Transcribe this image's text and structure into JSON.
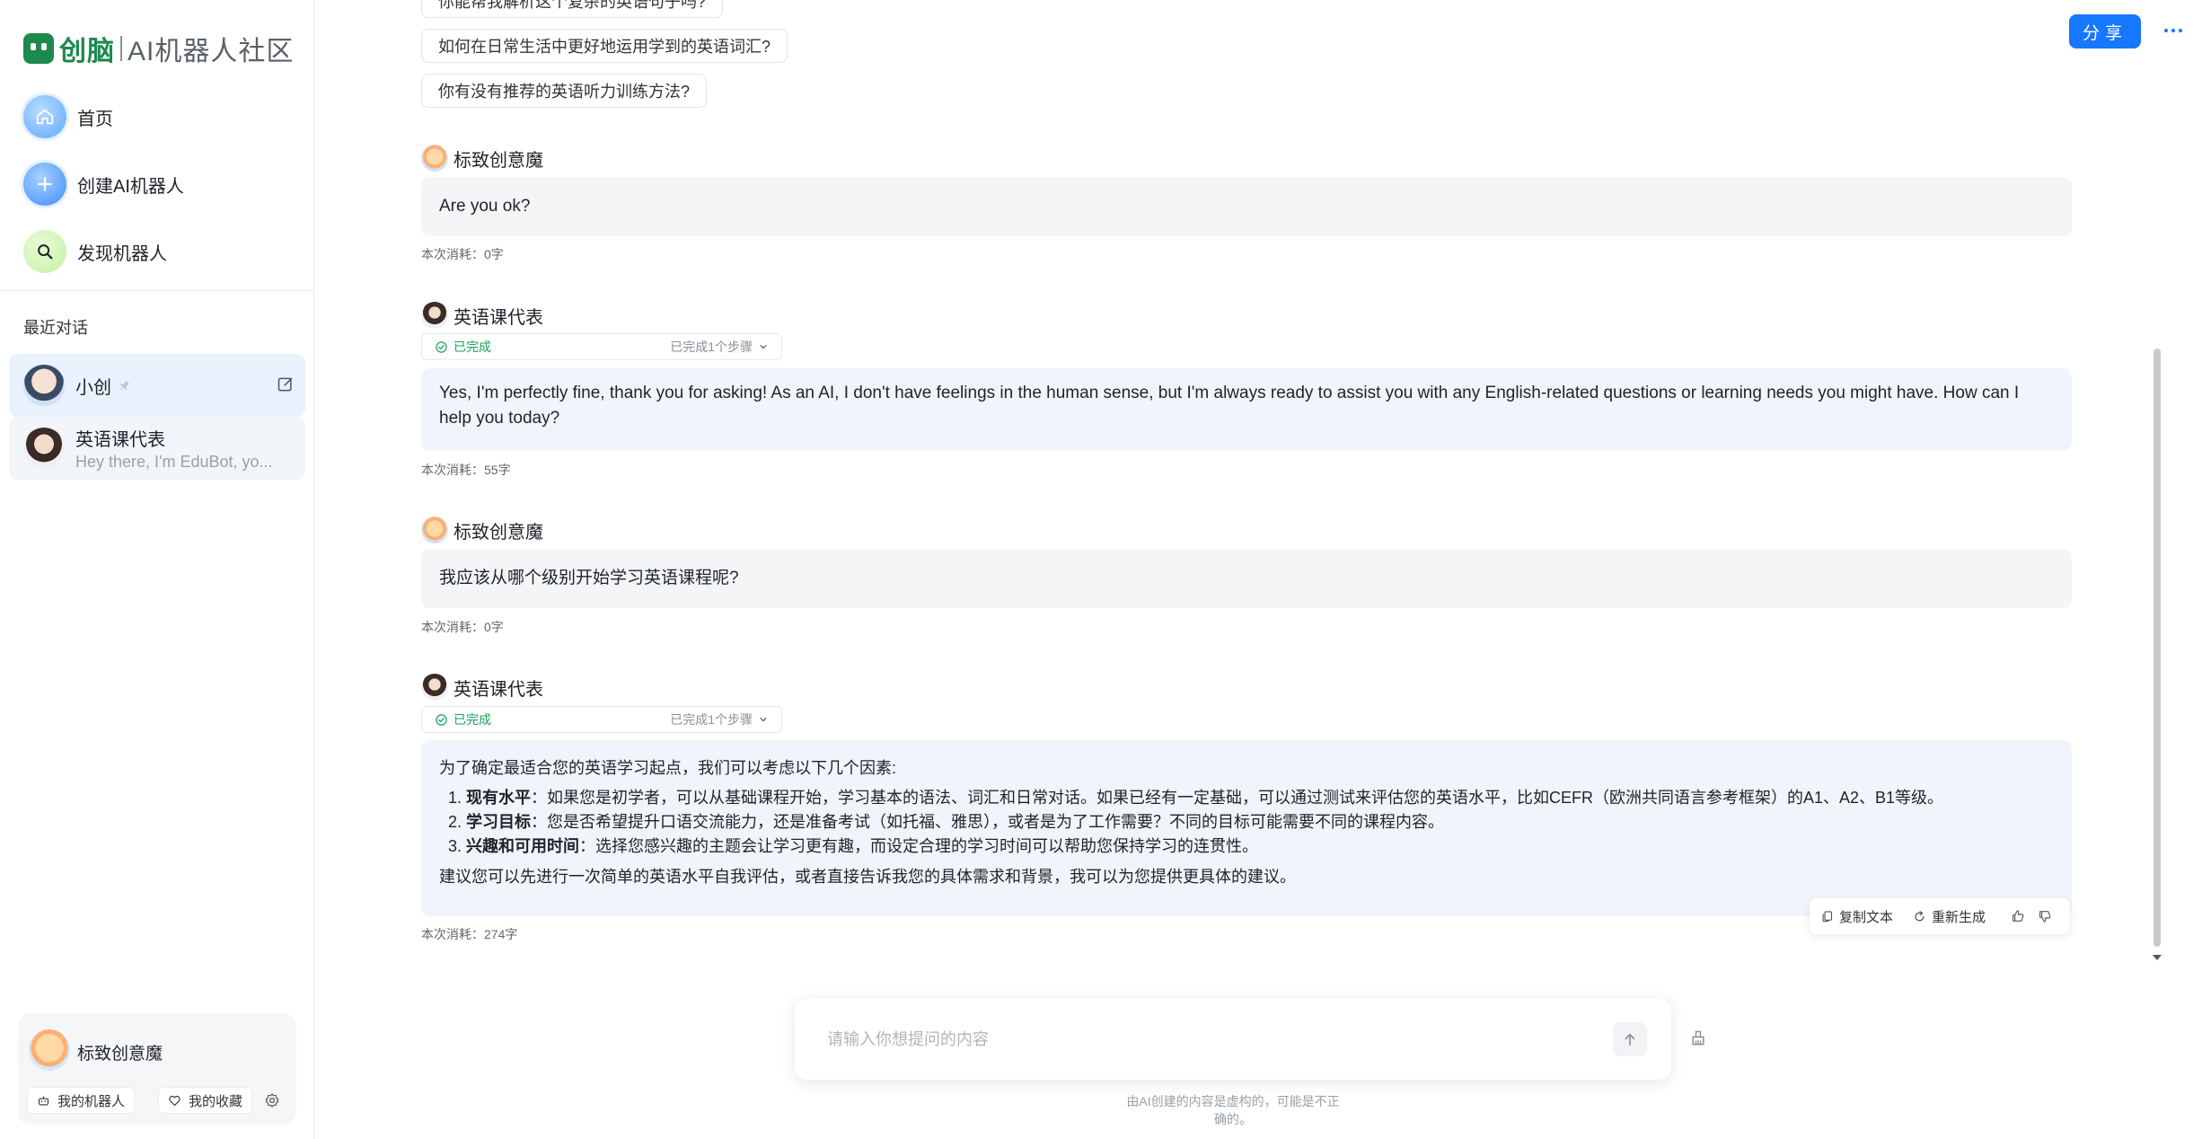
{
  "app": {
    "brand": "创脑",
    "tagline": "AI机器人社区"
  },
  "nav": {
    "home": "首页",
    "create": "创建AI机器人",
    "discover": "发现机器人"
  },
  "recent": {
    "title": "最近对话",
    "items": [
      {
        "name": "小创",
        "preview": ""
      },
      {
        "name": "英语课代表",
        "preview": "Hey there, I'm EduBot, yo..."
      }
    ]
  },
  "user": {
    "name": "标致创意魔",
    "my_bots": "我的机器人",
    "my_favorites": "我的收藏"
  },
  "header": {
    "share": "分享"
  },
  "suggestions": [
    "你能帮我解析这个复杂的英语句子吗?",
    "如何在日常生活中更好地运用学到的英语词汇?",
    "你有没有推荐的英语听力训练方法?"
  ],
  "messages": [
    {
      "sender": "标致创意魔",
      "text": "Are you ok?",
      "cost": "本次消耗：0字"
    },
    {
      "sender": "英语课代表",
      "status": "已完成",
      "steps": "已完成1个步骤",
      "text": "Yes, I'm perfectly fine, thank you for asking! As an AI, I don't have feelings in the human sense, but I'm always ready to assist you with any English-related questions or learning needs you might have. How can I help you today?",
      "cost": "本次消耗：55字"
    },
    {
      "sender": "标致创意魔",
      "text": "我应该从哪个级别开始学习英语课程呢?",
      "cost": "本次消耗：0字"
    },
    {
      "sender": "英语课代表",
      "status": "已完成",
      "steps": "已完成1个步骤",
      "intro": "为了确定最适合您的英语学习起点，我们可以考虑以下几个因素:",
      "points": [
        {
          "title": "现有水平",
          "text": "：如果您是初学者，可以从基础课程开始，学习基本的语法、词汇和日常对话。如果已经有一定基础，可以通过测试来评估您的英语水平，比如CEFR（欧洲共同语言参考框架）的A1、A2、B1等级。"
        },
        {
          "title": "学习目标",
          "text": "：您是否希望提升口语交流能力，还是准备考试（如托福、雅思），或者是为了工作需要？不同的目标可能需要不同的课程内容。"
        },
        {
          "title": "兴趣和可用时间",
          "text": "：选择您感兴趣的主题会让学习更有趣，而设定合理的学习时间可以帮助您保持学习的连贯性。"
        }
      ],
      "outro": "建议您可以先进行一次简单的英语水平自我评估，或者直接告诉我您的具体需求和背景，我可以为您提供更具体的建议。",
      "cost": "本次消耗：274字"
    }
  ],
  "actions": {
    "copy": "复制文本",
    "regenerate": "重新生成"
  },
  "input": {
    "placeholder": "请输入你想提问的内容"
  },
  "disclaimer": "由AI创建的内容是虚构的，可能是不正确的。",
  "colors": {
    "brand_green": "#1c8a4d",
    "accent_blue": "#1677ff",
    "done_green": "#1aa35a"
  }
}
